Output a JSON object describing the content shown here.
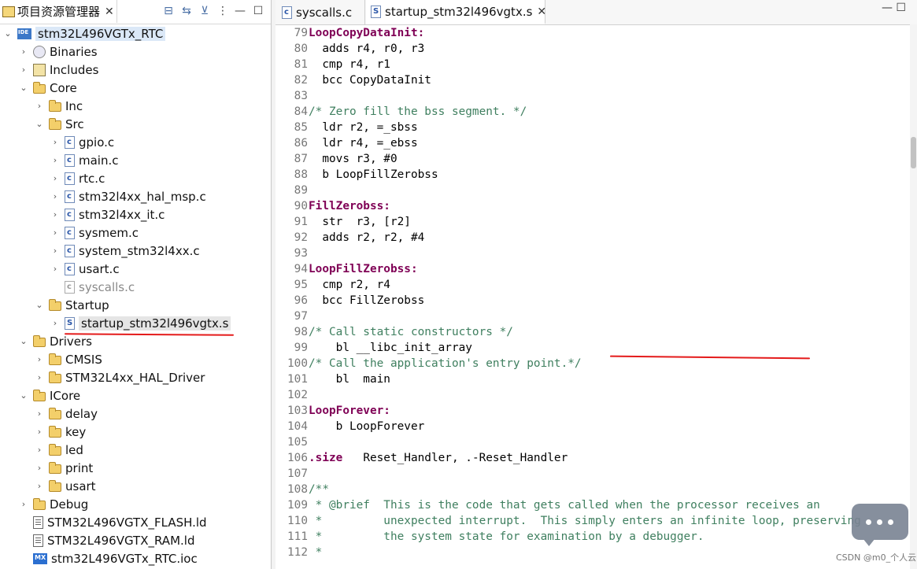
{
  "explorer": {
    "title": "项目资源管理器",
    "close_glyph": "✕",
    "toolbar": [
      "⊟",
      "⇆",
      "⊻",
      "⋮",
      "—",
      "☐"
    ],
    "tree": [
      {
        "label": "stm32L496VGTx_RTC",
        "level": 0,
        "chev": "⌄",
        "icon": "ide-project-icon",
        "selected": "project"
      },
      {
        "label": "Binaries",
        "level": 1,
        "chev": "›",
        "icon": "binaries-icon"
      },
      {
        "label": "Includes",
        "level": 1,
        "chev": "›",
        "icon": "includes-icon"
      },
      {
        "label": "Core",
        "level": 1,
        "chev": "⌄",
        "icon": "folder-icon"
      },
      {
        "label": "Inc",
        "level": 2,
        "chev": "›",
        "icon": "folder-icon"
      },
      {
        "label": "Src",
        "level": 2,
        "chev": "⌄",
        "icon": "folder-icon"
      },
      {
        "label": "gpio.c",
        "level": 3,
        "chev": "›",
        "icon": "c-file-icon"
      },
      {
        "label": "main.c",
        "level": 3,
        "chev": "›",
        "icon": "c-file-icon"
      },
      {
        "label": "rtc.c",
        "level": 3,
        "chev": "›",
        "icon": "c-file-icon"
      },
      {
        "label": "stm32l4xx_hal_msp.c",
        "level": 3,
        "chev": "›",
        "icon": "c-file-icon"
      },
      {
        "label": "stm32l4xx_it.c",
        "level": 3,
        "chev": "›",
        "icon": "c-file-icon"
      },
      {
        "label": "sysmem.c",
        "level": 3,
        "chev": "›",
        "icon": "c-file-icon"
      },
      {
        "label": "system_stm32l4xx.c",
        "level": 3,
        "chev": "›",
        "icon": "c-file-icon"
      },
      {
        "label": "usart.c",
        "level": 3,
        "chev": "›",
        "icon": "c-file-icon"
      },
      {
        "label": "syscalls.c",
        "level": 3,
        "chev": "",
        "icon": "c-file-excluded-icon",
        "dim": true
      },
      {
        "label": "Startup",
        "level": 2,
        "chev": "⌄",
        "icon": "folder-icon"
      },
      {
        "label": "startup_stm32l496vgtx.s",
        "level": 3,
        "chev": "›",
        "icon": "s-file-icon",
        "selected": "file"
      },
      {
        "label": "Drivers",
        "level": 1,
        "chev": "⌄",
        "icon": "folder-icon"
      },
      {
        "label": "CMSIS",
        "level": 2,
        "chev": "›",
        "icon": "folder-icon"
      },
      {
        "label": "STM32L4xx_HAL_Driver",
        "level": 2,
        "chev": "›",
        "icon": "folder-icon"
      },
      {
        "label": "ICore",
        "level": 1,
        "chev": "⌄",
        "icon": "folder-icon"
      },
      {
        "label": "delay",
        "level": 2,
        "chev": "›",
        "icon": "folder-icon"
      },
      {
        "label": "key",
        "level": 2,
        "chev": "›",
        "icon": "folder-icon"
      },
      {
        "label": "led",
        "level": 2,
        "chev": "›",
        "icon": "folder-icon"
      },
      {
        "label": "print",
        "level": 2,
        "chev": "›",
        "icon": "folder-icon"
      },
      {
        "label": "usart",
        "level": 2,
        "chev": "›",
        "icon": "folder-icon"
      },
      {
        "label": "Debug",
        "level": 1,
        "chev": "›",
        "icon": "folder-icon"
      },
      {
        "label": "STM32L496VGTX_FLASH.ld",
        "level": 1,
        "chev": "",
        "icon": "ld-file-icon"
      },
      {
        "label": "STM32L496VGTX_RAM.ld",
        "level": 1,
        "chev": "",
        "icon": "ld-file-icon"
      },
      {
        "label": "stm32L496VGTx_RTC.ioc",
        "level": 1,
        "chev": "",
        "icon": "mx-file-icon"
      }
    ]
  },
  "editor": {
    "tabs": [
      {
        "label": "syscalls.c",
        "active": false,
        "icon": "c-file-icon"
      },
      {
        "label": "startup_stm32l496vgtx.s",
        "active": true,
        "icon": "s-file-icon",
        "close": "✕"
      }
    ],
    "tab_controls": "—  ☐",
    "lines": [
      {
        "n": "79",
        "parts": [
          {
            "t": "LoopCopyDataInit:",
            "c": "lab"
          }
        ]
      },
      {
        "n": "80",
        "parts": [
          {
            "t": "  adds r4, r0, r3",
            "c": ""
          }
        ]
      },
      {
        "n": "81",
        "parts": [
          {
            "t": "  cmp r4, r1",
            "c": ""
          }
        ]
      },
      {
        "n": "82",
        "parts": [
          {
            "t": "  bcc CopyDataInit",
            "c": ""
          }
        ]
      },
      {
        "n": "83",
        "parts": []
      },
      {
        "n": "84",
        "parts": [
          {
            "t": "/* Zero fill the bss segment. */",
            "c": "cmt"
          }
        ]
      },
      {
        "n": "85",
        "parts": [
          {
            "t": "  ldr r2, =_sbss",
            "c": ""
          }
        ]
      },
      {
        "n": "86",
        "parts": [
          {
            "t": "  ldr r4, =_ebss",
            "c": ""
          }
        ]
      },
      {
        "n": "87",
        "parts": [
          {
            "t": "  movs r3, #0",
            "c": ""
          }
        ]
      },
      {
        "n": "88",
        "parts": [
          {
            "t": "  b LoopFillZerobss",
            "c": ""
          }
        ]
      },
      {
        "n": "89",
        "parts": []
      },
      {
        "n": "90",
        "parts": [
          {
            "t": "FillZerobss:",
            "c": "lab"
          }
        ]
      },
      {
        "n": "91",
        "parts": [
          {
            "t": "  str  r3, [r2]",
            "c": ""
          }
        ]
      },
      {
        "n": "92",
        "parts": [
          {
            "t": "  adds r2, r2, #4",
            "c": ""
          }
        ]
      },
      {
        "n": "93",
        "parts": []
      },
      {
        "n": "94",
        "parts": [
          {
            "t": "LoopFillZerobss:",
            "c": "lab"
          }
        ]
      },
      {
        "n": "95",
        "parts": [
          {
            "t": "  cmp r2, r4",
            "c": ""
          }
        ]
      },
      {
        "n": "96",
        "parts": [
          {
            "t": "  bcc FillZerobss",
            "c": ""
          }
        ]
      },
      {
        "n": "97",
        "parts": []
      },
      {
        "n": "98",
        "parts": [
          {
            "t": "/* Call static constructors */",
            "c": "cmt"
          }
        ]
      },
      {
        "n": "99",
        "parts": [
          {
            "t": "    bl __libc_init_array",
            "c": ""
          }
        ]
      },
      {
        "n": "100",
        "parts": [
          {
            "t": "/* Call the application's entry point.*/",
            "c": "cmt"
          }
        ]
      },
      {
        "n": "101",
        "parts": [
          {
            "t": "    bl  main",
            "c": ""
          }
        ]
      },
      {
        "n": "102",
        "parts": []
      },
      {
        "n": "103",
        "parts": [
          {
            "t": "LoopForever:",
            "c": "lab"
          }
        ]
      },
      {
        "n": "104",
        "parts": [
          {
            "t": "    b LoopForever",
            "c": ""
          }
        ]
      },
      {
        "n": "105",
        "parts": []
      },
      {
        "n": "106",
        "parts": [
          {
            "t": ".size",
            "c": "dir"
          },
          {
            "t": "   Reset_Handler, .-Reset_Handler",
            "c": ""
          }
        ]
      },
      {
        "n": "107",
        "parts": []
      },
      {
        "n": "108",
        "parts": [
          {
            "t": "/**",
            "c": "cmt"
          }
        ]
      },
      {
        "n": "109",
        "parts": [
          {
            "t": " * @brief  This is the code that gets called when the processor receives an",
            "c": "cmt"
          }
        ]
      },
      {
        "n": "110",
        "parts": [
          {
            "t": " *         unexpected interrupt.  This simply enters an infinite loop, preserving",
            "c": "cmt"
          }
        ]
      },
      {
        "n": "111",
        "parts": [
          {
            "t": " *         the system state for examination by a debugger.",
            "c": "cmt"
          }
        ]
      },
      {
        "n": "112",
        "parts": [
          {
            "t": " *",
            "c": "cmt"
          }
        ]
      }
    ]
  },
  "watermark": "CSDN @m0_个人云",
  "annotation_color": "#e41b1b"
}
